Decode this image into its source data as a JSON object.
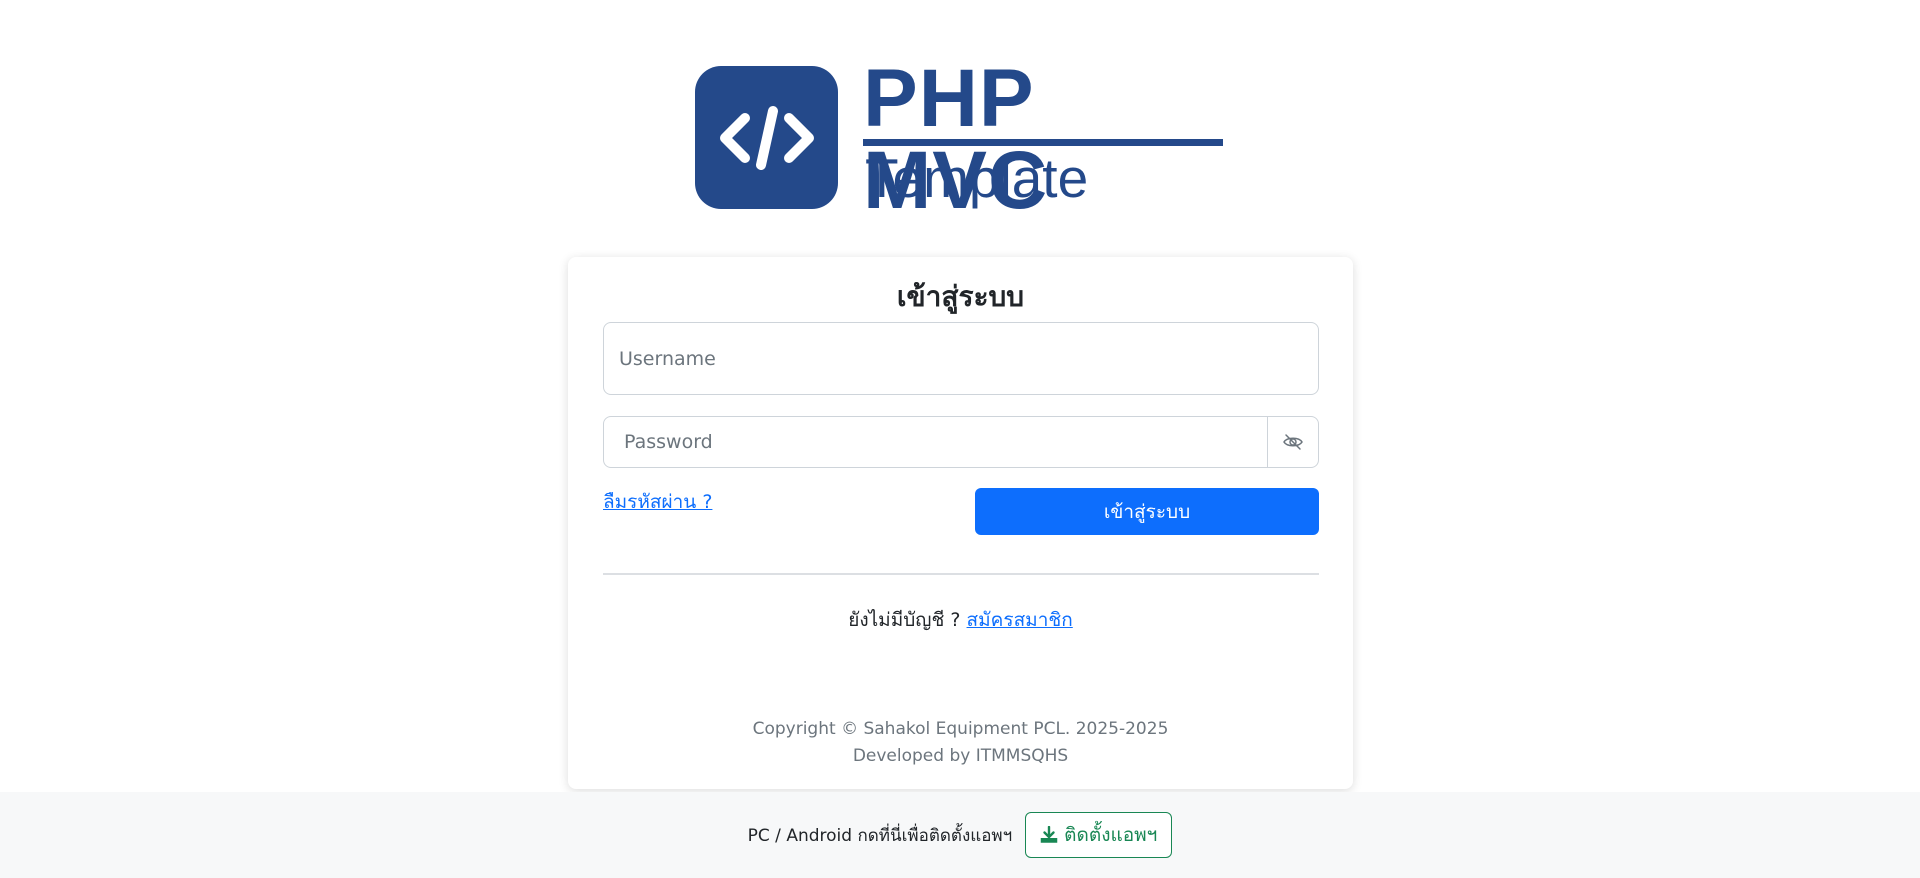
{
  "logo": {
    "title": "PHP MVC",
    "subtitle": "Template",
    "icon": "code-icon",
    "color": "#24498a"
  },
  "login": {
    "heading": "เข้าสู่ระบบ",
    "username_placeholder": "Username",
    "username_value": "",
    "password_placeholder": "Password",
    "password_value": "",
    "toggle_icon": "eye-slash-icon",
    "forgot_label": "ลืมรหัสผ่าน ?",
    "submit_label": "เข้าสู่ระบบ",
    "accent": "#0d6efd"
  },
  "register": {
    "prompt": "ยังไม่มีบัญชี ?",
    "link_label": "สมัครสมาชิก"
  },
  "footer": {
    "copyright": "Copyright © Sahakol Equipment PCL. 2025-2025",
    "developer": "Developed by ITMMSQHS"
  },
  "install_bar": {
    "text": "PC / Android กดที่นี่เพื่อติดตั้งแอพฯ",
    "button_label": "ติดตั้งแอพฯ",
    "button_icon": "download-icon",
    "color": "#198754"
  }
}
